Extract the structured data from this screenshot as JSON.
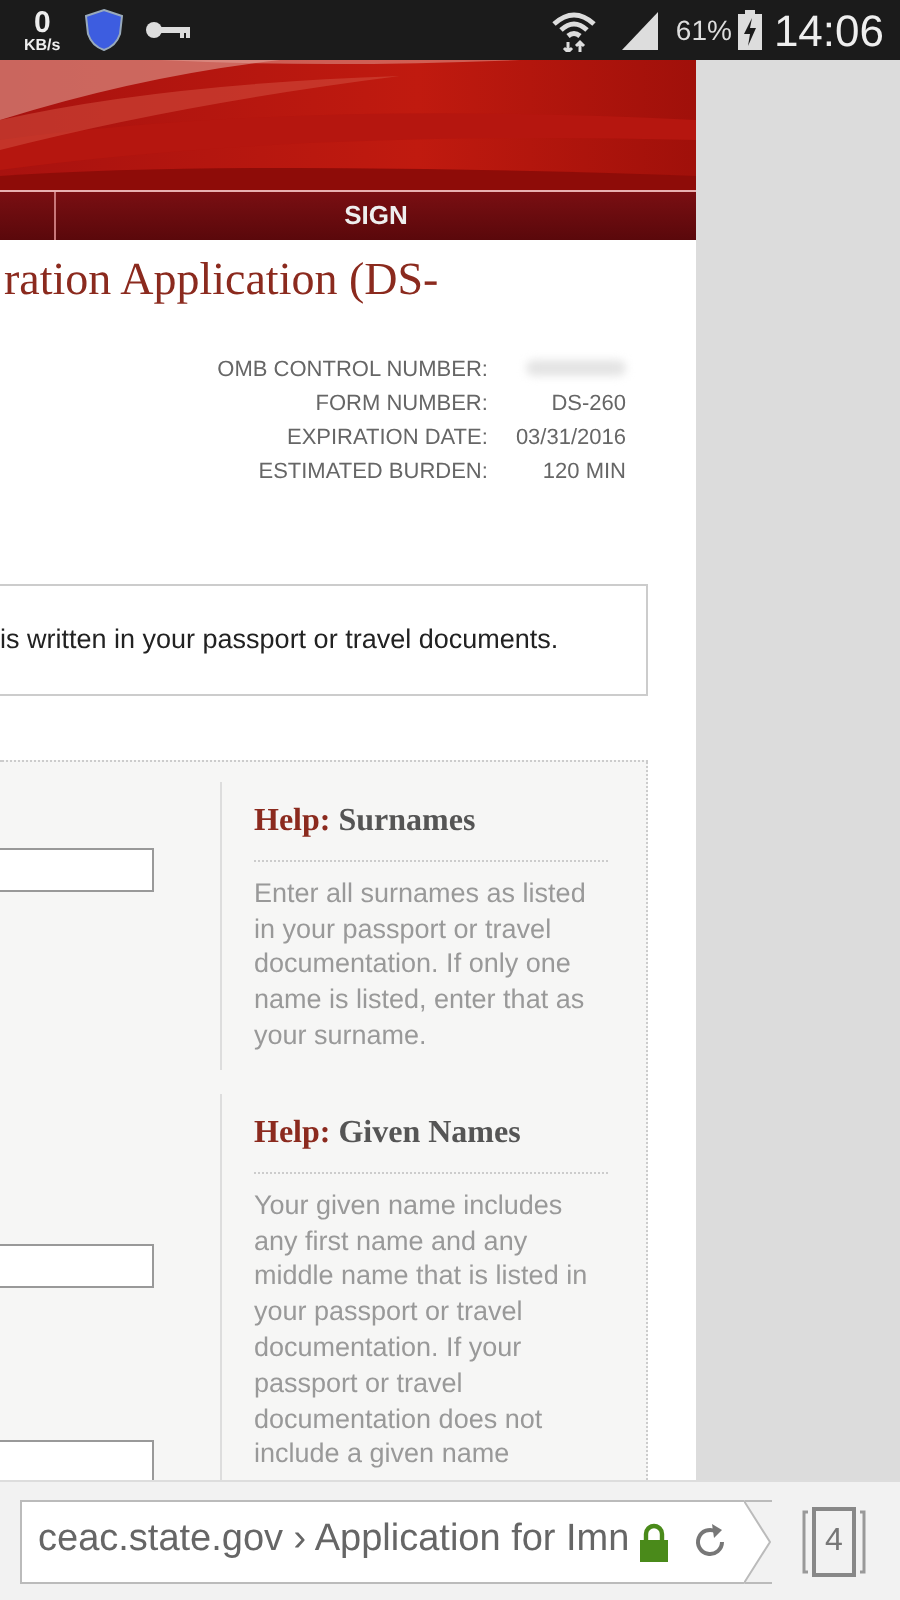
{
  "status_bar": {
    "speed_value": "0",
    "speed_unit": "KB/s",
    "battery": "61%",
    "time": "14:06"
  },
  "nav_tab": "SIGN",
  "page_title": "ration Application (DS-",
  "form_info": [
    {
      "label": "OMB CONTROL NUMBER:",
      "redacted": true
    },
    {
      "label": "FORM NUMBER:",
      "value": "DS-260",
      "redacted": false
    },
    {
      "label": "EXPIRATION DATE:",
      "value": "03/31/2016",
      "redacted": false
    },
    {
      "label": "ESTIMATED BURDEN:",
      "value": "120 MIN",
      "redacted": false
    }
  ],
  "notice": "is written in your passport or travel documents.",
  "form_fields": [
    {
      "kind": "text-input"
    },
    {
      "kind": "text-input"
    },
    {
      "kind": "text-input"
    }
  ],
  "help": [
    {
      "prefix": "Help:",
      "topic": "Surnames",
      "text": "Enter all surnames as listed in your passport or travel documentation. If only one name is listed, enter that as your surname."
    },
    {
      "prefix": "Help:",
      "topic": "Given Names",
      "text": "Your given name includes any first name and any middle name that is listed in your passport or travel documentation. If your passport or travel documentation does not include a given name"
    }
  ],
  "browser": {
    "address": "ceac.state.gov › Application for Imn",
    "tab_count": "4"
  }
}
